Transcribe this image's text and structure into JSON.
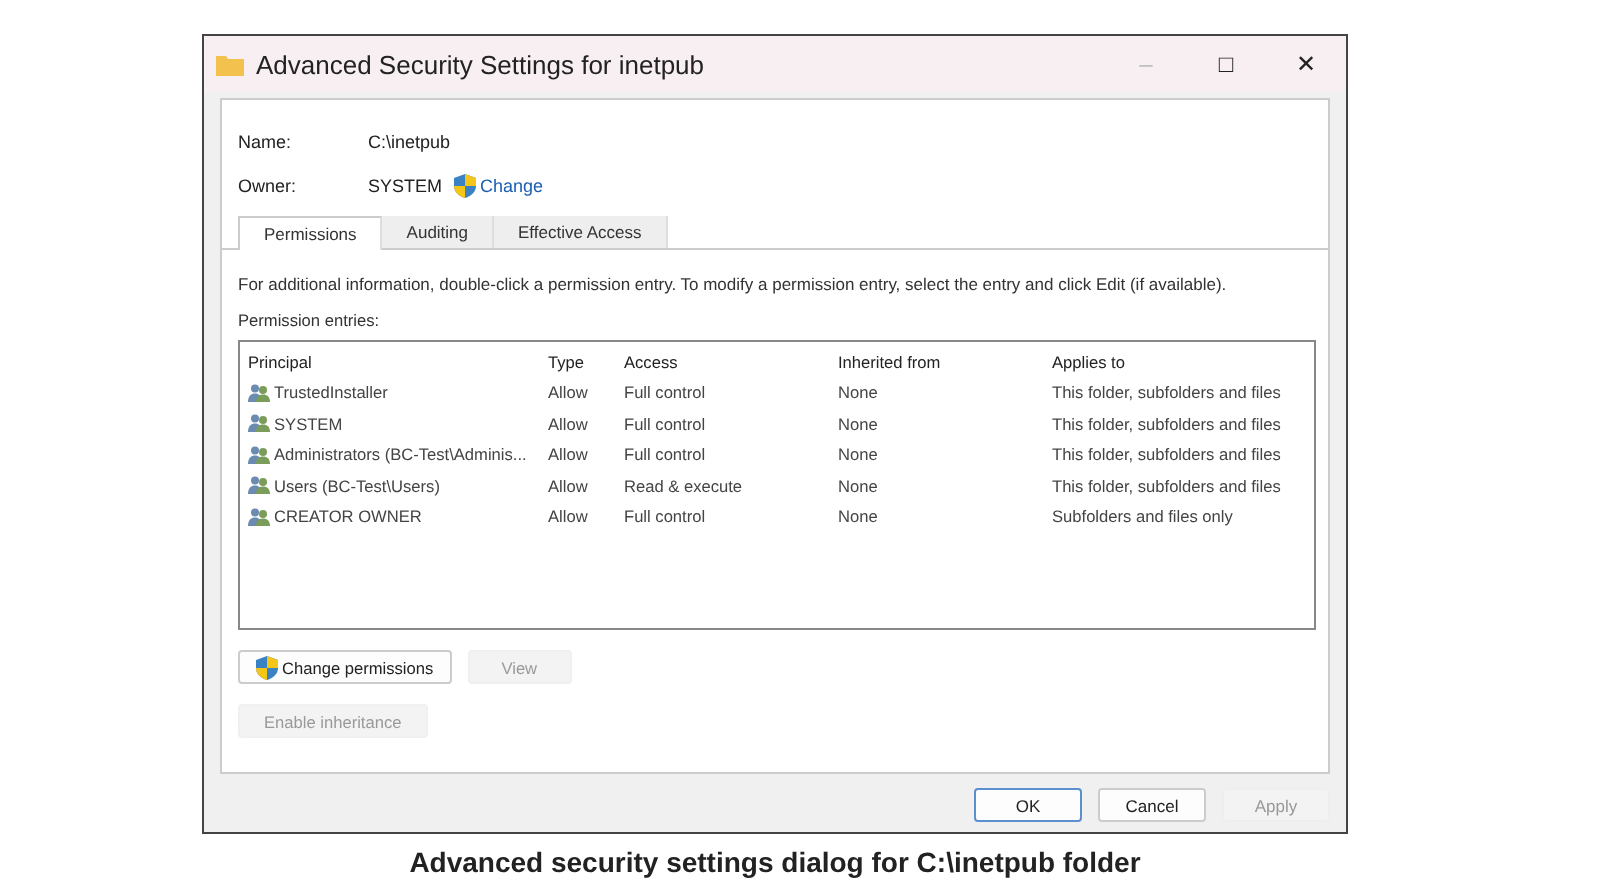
{
  "window": {
    "title": "Advanced Security Settings for inetpub",
    "controls": [
      "–",
      "□",
      "✕"
    ]
  },
  "name_field": {
    "label": "Name:",
    "value": "C:\\inetpub"
  },
  "owner": {
    "label": "Owner:",
    "value": "SYSTEM",
    "link": "Change"
  },
  "tabs": [
    {
      "label": "Permissions",
      "selected": true
    },
    {
      "label": "Auditing",
      "selected": false
    },
    {
      "label": "Effective Access",
      "selected": false
    }
  ],
  "info_text": "For additional information, double-click a permission entry. To modify a permission entry, select the entry and click Edit (if available).",
  "entries_label": "Permission entries:",
  "table": {
    "columns": [
      "Principal",
      "Type",
      "Access",
      "Inherited from",
      "Applies to"
    ],
    "rows": [
      {
        "cells": [
          "TrustedInstaller",
          "Allow",
          "Full control",
          "None",
          "This folder, subfolders and files"
        ]
      },
      {
        "cells": [
          "SYSTEM",
          "Allow",
          "Full control",
          "None",
          "This folder, subfolders and files"
        ]
      },
      {
        "cells": [
          "Administrators (BC-Test\\Adminis...",
          "Allow",
          "Full control",
          "None",
          "This folder, subfolders and files"
        ]
      },
      {
        "cells": [
          "Users (BC-Test\\Users)",
          "Allow",
          "Read & execute",
          "None",
          "This folder, subfolders and files"
        ]
      },
      {
        "cells": [
          "CREATOR OWNER",
          "Allow",
          "Full control",
          "None",
          "Subfolders and files only"
        ]
      }
    ]
  },
  "action_buttons": [
    {
      "label": "Change permissions",
      "shield": true,
      "disabled": false
    },
    {
      "label": "View",
      "shield": false,
      "disabled": true
    }
  ],
  "inheritance_button": {
    "label": "Enable inheritance",
    "disabled": true
  },
  "footer_buttons": [
    {
      "label": "OK",
      "disabled": false,
      "default": true
    },
    {
      "label": "Cancel",
      "disabled": false,
      "default": false
    },
    {
      "label": "Apply",
      "disabled": true,
      "default": false
    }
  ],
  "caption": "Advanced security settings dialog for C:\\inetpub folder"
}
